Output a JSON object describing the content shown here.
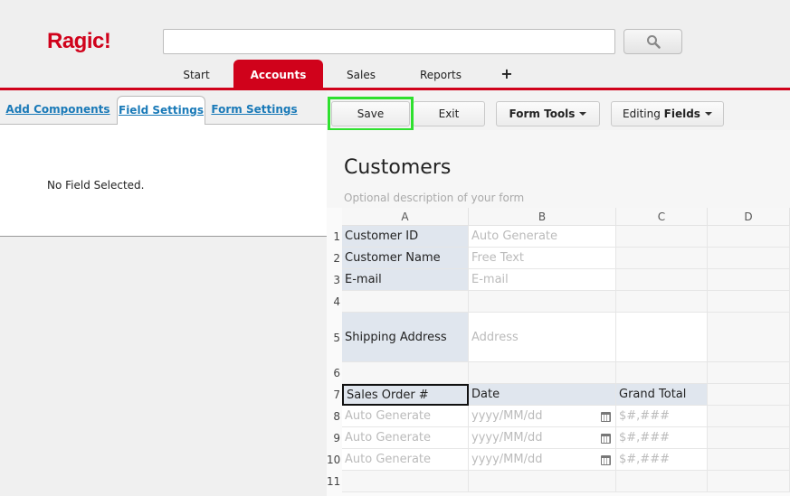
{
  "header": {
    "logo": "Ragic!",
    "search": {
      "value": "",
      "placeholder": ""
    }
  },
  "nav": {
    "tabs": [
      {
        "label": "Start"
      },
      {
        "label": "Accounts",
        "active": true
      },
      {
        "label": "Sales"
      },
      {
        "label": "Reports"
      },
      {
        "label": "+"
      }
    ]
  },
  "left_panel": {
    "tabs": [
      "Add Components",
      "Field Settings",
      "Form Settings"
    ],
    "active_tab": "Field Settings",
    "message": "No Field Selected."
  },
  "toolbar": {
    "save_label": "Save",
    "exit_label": "Exit",
    "form_tools_label": "Form Tools",
    "editing_prefix": "Editing",
    "editing_bold": "Fields"
  },
  "form": {
    "title": "Customers",
    "description": "Optional description of your form",
    "columns": [
      "A",
      "B",
      "C",
      "D"
    ],
    "row_numbers": [
      "1",
      "2",
      "3",
      "4",
      "5",
      "6",
      "7",
      "8",
      "9",
      "10",
      "11"
    ],
    "cells": {
      "r1a": "Customer ID",
      "r1b": "Auto Generate",
      "r2a": "Customer Name",
      "r2b": "Free Text",
      "r3a": "E-mail",
      "r3b": "E-mail",
      "r5a": "Shipping Address",
      "r5b": "Address",
      "r7a": "Sales Order #",
      "r7b": "Date",
      "r7c": "Grand Total",
      "r8a": "Auto Generate",
      "r8b": "yyyy/MM/dd",
      "r8c": "$#,###",
      "r9a": "Auto Generate",
      "r9b": "yyyy/MM/dd",
      "r9c": "$#,###",
      "r10a": "Auto Generate",
      "r10b": "yyyy/MM/dd",
      "r10c": "$#,###"
    }
  },
  "colors": {
    "brand_red": "#d0021b",
    "highlight_green": "#2ee02e",
    "label_cell": "#e0e6ee"
  }
}
